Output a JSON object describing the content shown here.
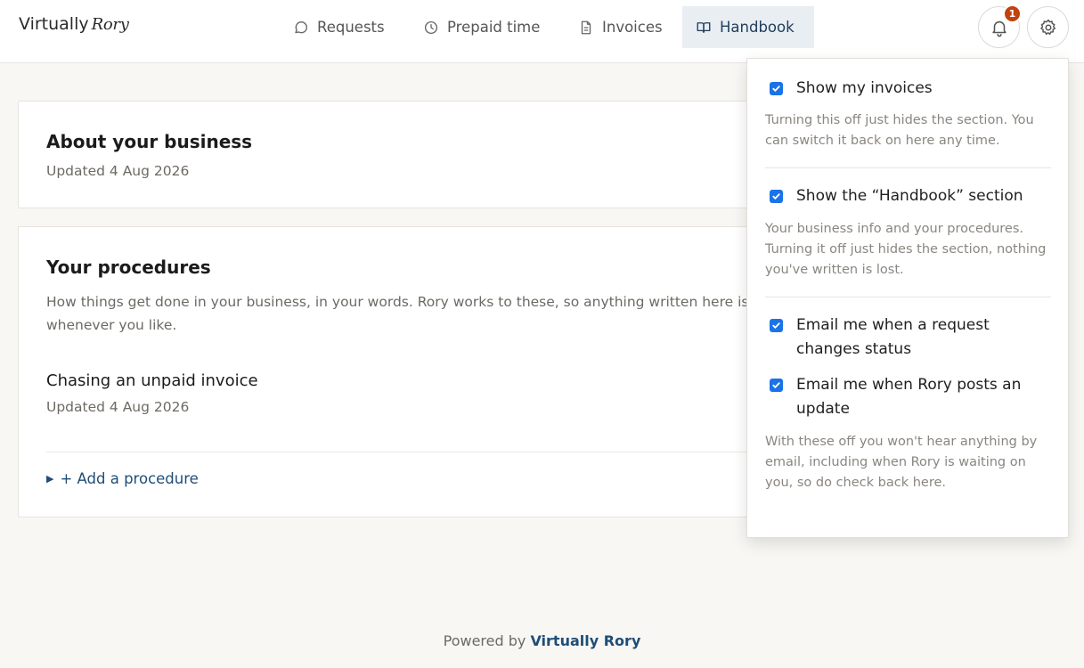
{
  "app": {
    "logo_part1": "Virtually",
    "logo_part2": "Rory",
    "notifications_count": "1",
    "accent_color": "#1a73e8",
    "badge_color": "#c2410c"
  },
  "nav": {
    "requests": "Requests",
    "prepaid": "Prepaid time",
    "invoices": "Invoices",
    "handbook": "Handbook"
  },
  "about": {
    "title": "About your business",
    "updated": "Updated 4 Aug 2026"
  },
  "procedures": {
    "title": "Your procedures",
    "description": "How things get done in your business, in your words. Rory works to these, so anything written here is one to edit whenever you like.",
    "items": [
      {
        "title": "Chasing an unpaid invoice",
        "updated": "Updated 4 Aug 2026"
      }
    ],
    "add_label": "+ Add a procedure"
  },
  "settings": {
    "show_invoices": {
      "label": "Show my invoices",
      "checked": true
    },
    "show_invoices_hint": "Turning this off just hides the section. You can switch it back on here any time.",
    "show_handbook": {
      "label": "Show the “Handbook” section",
      "checked": true
    },
    "show_handbook_hint": "Your business info and your procedures. Turning it off just hides the section, nothing you've written is lost.",
    "email_status": {
      "label": "Email me when a request changes status",
      "checked": true
    },
    "email_update": {
      "label": "Email me when Rory posts an update",
      "checked": true
    },
    "email_hint": "With these off you won't hear anything by email, including when Rory is waiting on you, so do check back here."
  },
  "footer": {
    "prefix": "Powered by ",
    "brand": "Virtually Rory"
  }
}
